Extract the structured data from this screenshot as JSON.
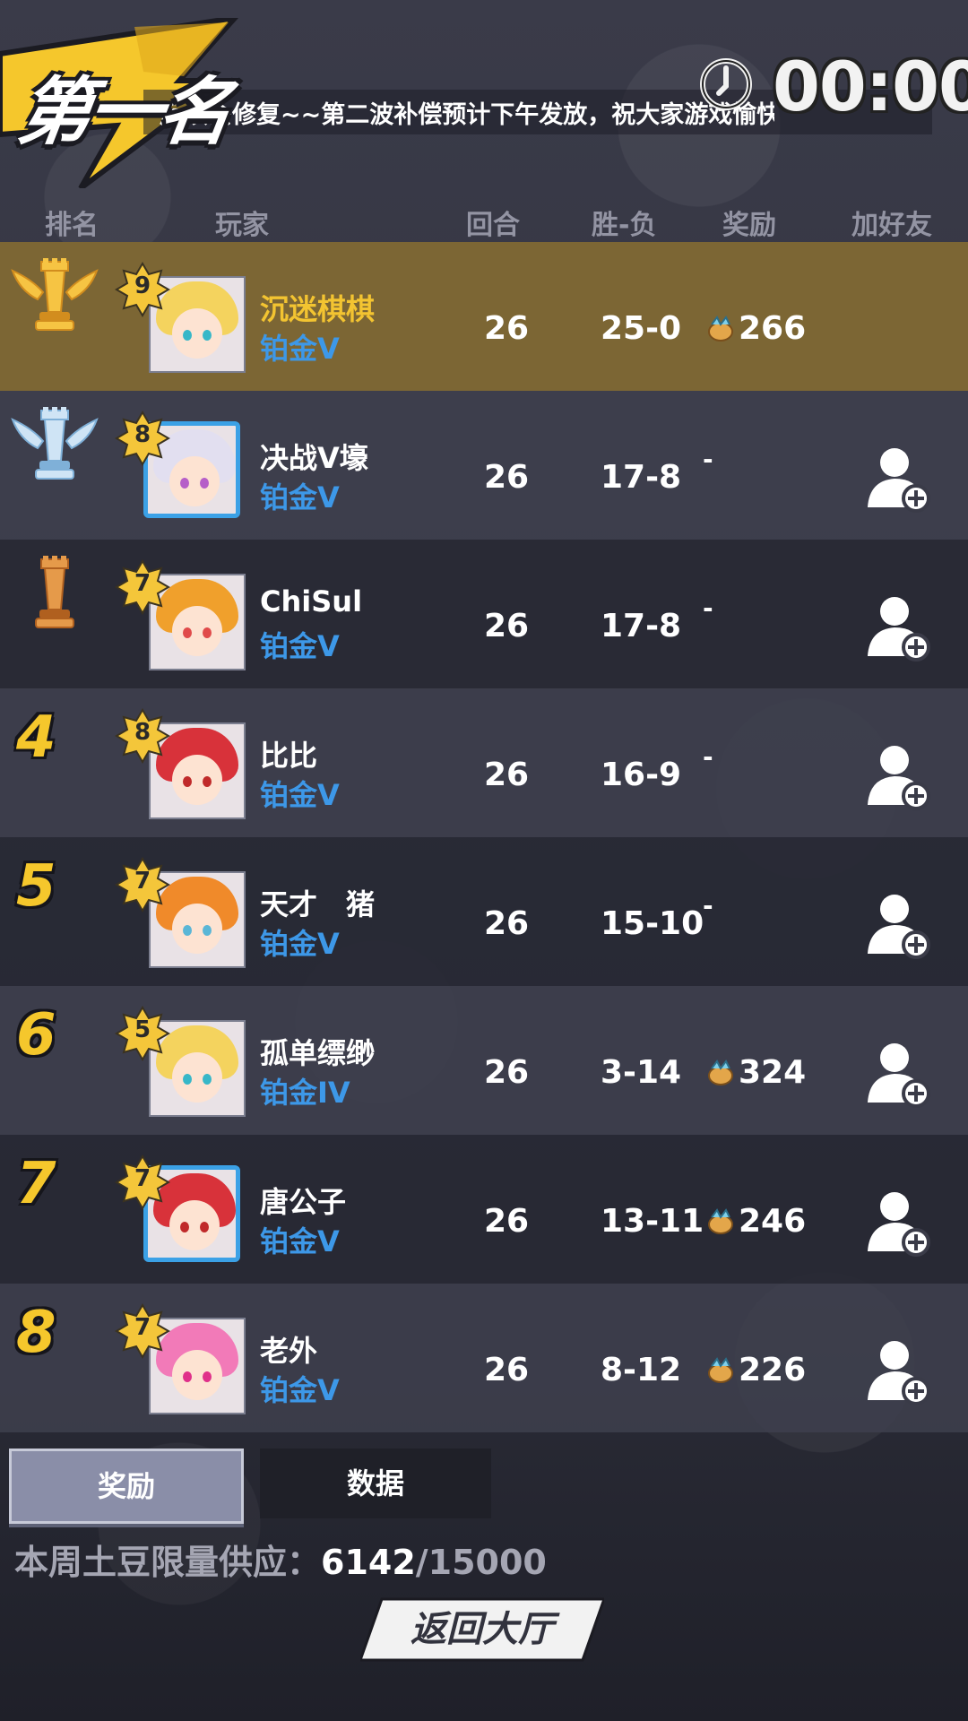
{
  "header": {
    "rank_title": "第一名",
    "marquee": "后续会修复~~第二波补偿预计下午发放，祝大家游戏愉快",
    "timer": "00:00"
  },
  "columns": [
    "排名",
    "玩家",
    "回合",
    "胜-负",
    "奖励",
    "加好友"
  ],
  "players": [
    {
      "rank": "1",
      "trophy": "gold",
      "level": "9",
      "name": "沉迷棋棋",
      "tier": "铂金V",
      "rounds": "26",
      "wl": "25-0",
      "reward": "266",
      "add_friend": false,
      "avatar": {
        "hair": "#f4d35e",
        "eyes": "#37b7c8",
        "frame": "plain"
      }
    },
    {
      "rank": "2",
      "trophy": "silver",
      "level": "8",
      "name": "决战V壕",
      "tier": "铂金V",
      "rounds": "26",
      "wl": "17-8",
      "reward": "-",
      "add_friend": true,
      "avatar": {
        "hair": "#e2dff0",
        "eyes": "#b65ec8",
        "frame": "blue"
      }
    },
    {
      "rank": "3",
      "trophy": "bronze",
      "level": "7",
      "name": "ChiSul",
      "tier": "铂金V",
      "rounds": "26",
      "wl": "17-8",
      "reward": "-",
      "add_friend": true,
      "avatar": {
        "hair": "#f0a02c",
        "eyes": "#e04a4a",
        "frame": "plain"
      }
    },
    {
      "rank": "4",
      "trophy": "",
      "level": "8",
      "name": "比比",
      "tier": "铂金V",
      "rounds": "26",
      "wl": "16-9",
      "reward": "-",
      "add_friend": true,
      "avatar": {
        "hair": "#d8323a",
        "eyes": "#c02a2a",
        "frame": "plain"
      }
    },
    {
      "rank": "5",
      "trophy": "",
      "level": "7",
      "name": "天才　猪",
      "tier": "铂金V",
      "rounds": "26",
      "wl": "15-10",
      "reward": "-",
      "add_friend": true,
      "avatar": {
        "hair": "#f08a2a",
        "eyes": "#5ab6d6",
        "frame": "plain"
      }
    },
    {
      "rank": "6",
      "trophy": "",
      "level": "5",
      "name": "孤单缥缈",
      "tier": "铂金IV",
      "rounds": "26",
      "wl": "3-14",
      "reward": "324",
      "add_friend": true,
      "avatar": {
        "hair": "#f4d35e",
        "eyes": "#37b7c8",
        "frame": "plain"
      }
    },
    {
      "rank": "7",
      "trophy": "",
      "level": "7",
      "name": "唐公子",
      "tier": "铂金V",
      "rounds": "26",
      "wl": "13-11",
      "reward": "246",
      "add_friend": true,
      "avatar": {
        "hair": "#d8323a",
        "eyes": "#c02a2a",
        "frame": "blue"
      }
    },
    {
      "rank": "8",
      "trophy": "",
      "level": "7",
      "name": "老外",
      "tier": "铂金V",
      "rounds": "26",
      "wl": "8-12",
      "reward": "226",
      "add_friend": true,
      "avatar": {
        "hair": "#f27ab8",
        "eyes": "#e0308a",
        "frame": "plain"
      }
    }
  ],
  "tabs": {
    "reward": "奖励",
    "data": "数据"
  },
  "supply": {
    "label": "本周土豆限量供应：",
    "current": "6142",
    "total": "/15000"
  },
  "back_button": "返回大厅",
  "colors": {
    "gold_row": "#7c6634",
    "tier_blue": "#3d98e8",
    "rank_yellow": "#f5c72c"
  }
}
